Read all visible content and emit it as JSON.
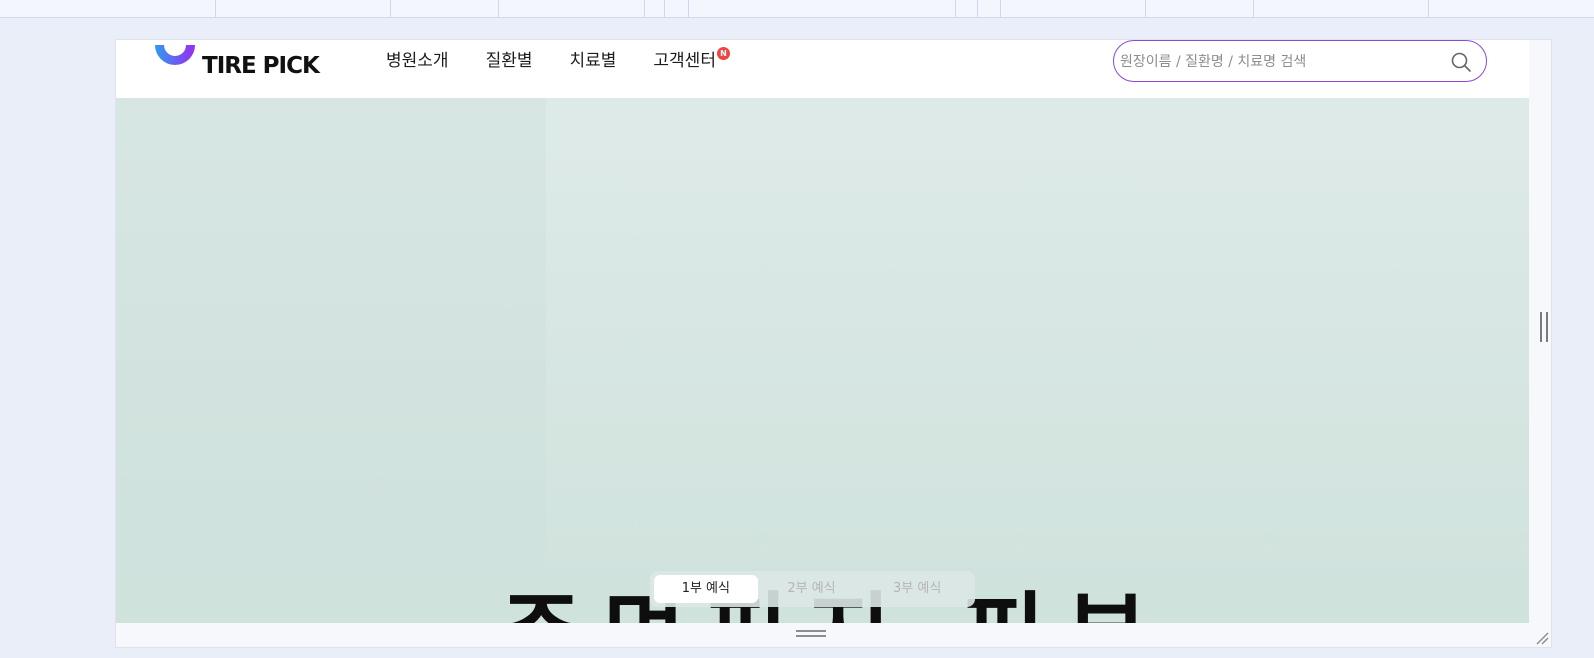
{
  "brand": {
    "name": "TIRE PICK",
    "colors": {
      "gradient_start": "#2f9bf0",
      "gradient_end": "#9a2cf0",
      "text": "#111111"
    }
  },
  "nav": {
    "items": [
      {
        "label": "병원소개"
      },
      {
        "label": "질환별"
      },
      {
        "label": "치료별"
      },
      {
        "label": "고객센터",
        "badge": "N"
      }
    ]
  },
  "search": {
    "placeholder": "원장이름 / 질환명 / 치료명 검색",
    "icon": "search-icon",
    "border_color": "#8a48d8"
  },
  "hero": {
    "background_color": "#d2e3df",
    "tabs": [
      {
        "label": "1부 예식",
        "active": true
      },
      {
        "label": "2부 예식",
        "active": false
      },
      {
        "label": "3부 예식",
        "active": false
      }
    ],
    "headline": "주먹피지 피부…"
  },
  "badge_color": "#ee4444"
}
